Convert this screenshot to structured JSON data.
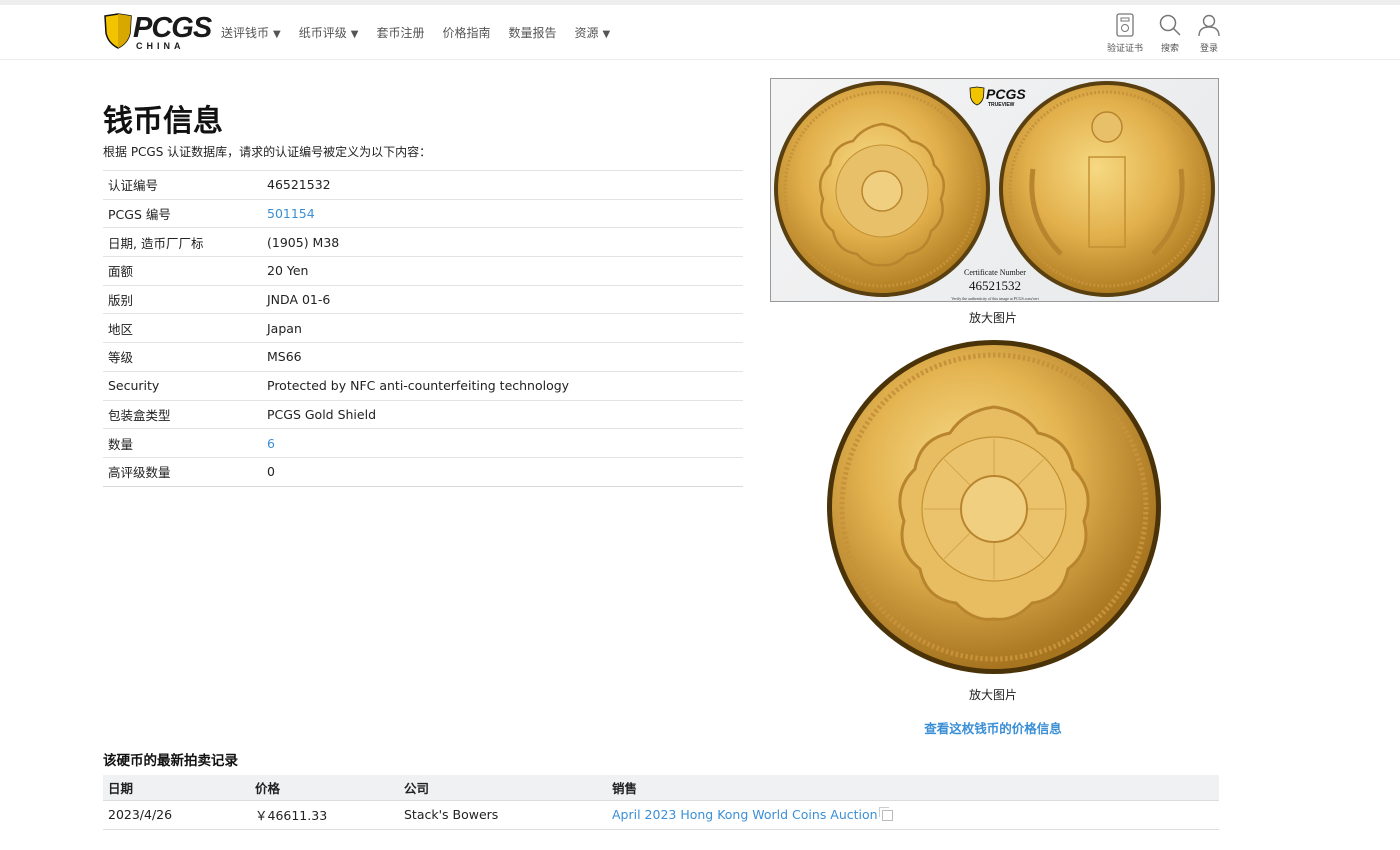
{
  "header": {
    "logo_text": "PCGS",
    "logo_sub": "CHINA",
    "nav": [
      {
        "label": "送评钱币",
        "caret": "▼"
      },
      {
        "label": "纸币评级",
        "caret": "▼"
      },
      {
        "label": "套币注册",
        "caret": ""
      },
      {
        "label": "价格指南",
        "caret": ""
      },
      {
        "label": "数量报告",
        "caret": ""
      },
      {
        "label": "资源",
        "caret": "▼"
      }
    ],
    "utilities": {
      "verify": "验证证书",
      "search": "搜索",
      "login": "登录"
    }
  },
  "main": {
    "title": "钱币信息",
    "intro": "根据 PCGS 认证数据库，请求的认证编号被定义为以下内容：",
    "rows": [
      {
        "key": "认证编号",
        "value": "46521532"
      },
      {
        "key": "PCGS 编号",
        "value": "501154"
      },
      {
        "key": "日期, 造币厂厂标",
        "value": "(1905) M38"
      },
      {
        "key": "面额",
        "value": "20 Yen"
      },
      {
        "key": "版别",
        "value": "JNDA 01-6"
      },
      {
        "key": "地区",
        "value": "Japan"
      },
      {
        "key": "等级",
        "value": "MS66"
      },
      {
        "key": "Security",
        "value": "Protected by NFC anti-counterfeiting technology"
      },
      {
        "key": "包装盒类型",
        "value": "PCGS Gold Shield"
      },
      {
        "key": "数量",
        "value": "6"
      },
      {
        "key": "高评级数量",
        "value": "0"
      }
    ]
  },
  "images": {
    "slab_cert_label": "Certificate Number",
    "slab_cert_number": "46521532",
    "slab_verify_note": "Verify the authenticity of this image at PCGS.com/cert",
    "slab_brand": "TRUEVIEW",
    "enlarge_1": "放大图片",
    "enlarge_2": "放大图片",
    "price_link": "查看这枚钱币的价格信息"
  },
  "auction": {
    "title": "该硬币的最新拍卖记录",
    "headers": [
      "日期",
      "价格",
      "公司",
      "销售"
    ],
    "rows": [
      {
        "date": "2023/4/26",
        "price": "￥46611.33",
        "company": "Stack's Bowers",
        "sale": "April 2023 Hong Kong World Coins Auction"
      }
    ]
  },
  "colors": {
    "link": "#3b8fd6",
    "shield": "#f2c400",
    "gold": "#e0b24a"
  }
}
